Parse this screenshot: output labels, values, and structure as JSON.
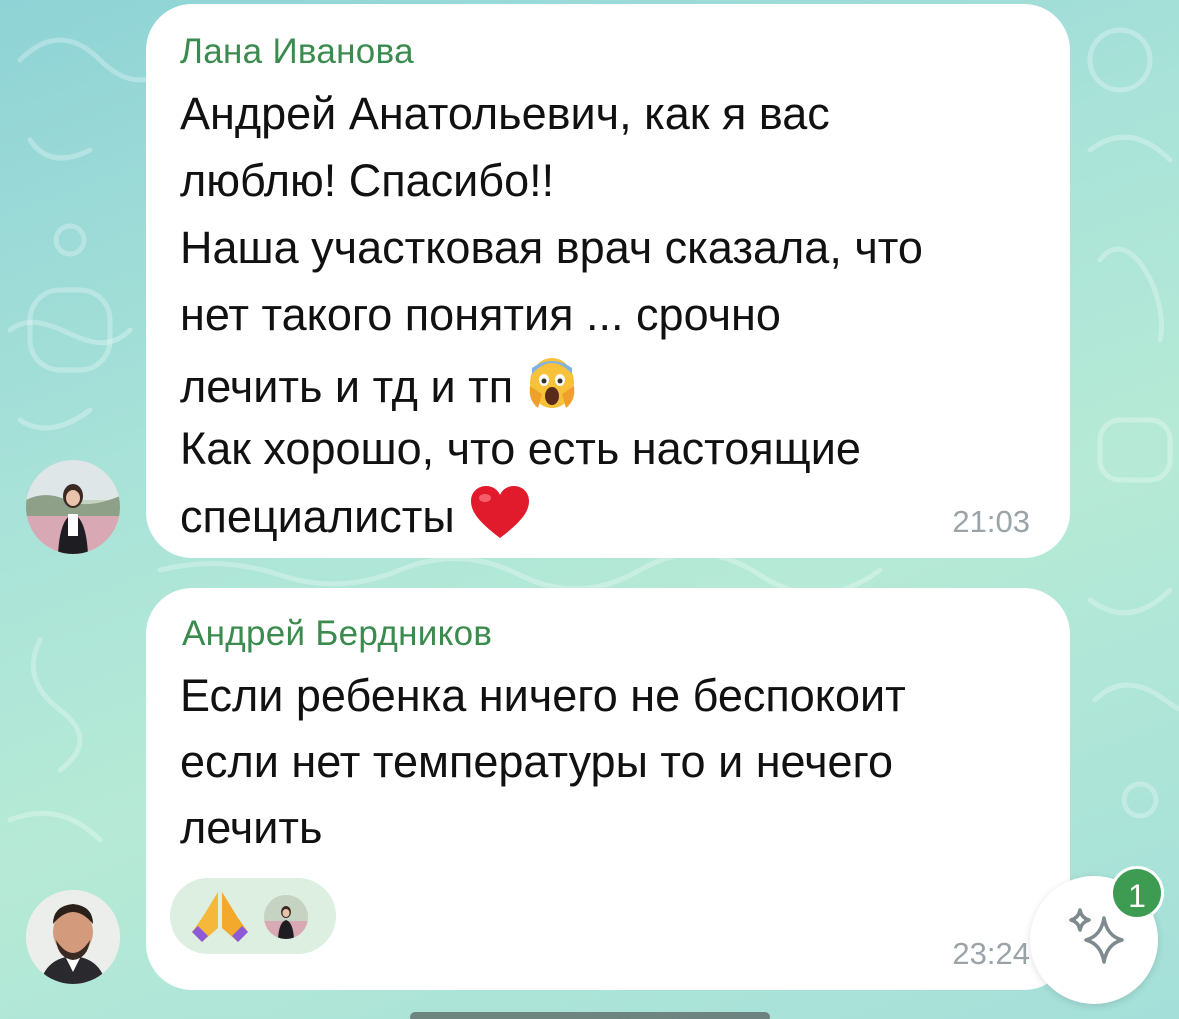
{
  "messages": [
    {
      "sender": "Лана Иванова",
      "lines": [
        "Андрей Анатольевич, как я вас",
        "люблю! Спасибо!!",
        "Наша участковая врач сказала, что",
        "нет такого понятия  ... срочно",
        "лечить и тд и тп",
        "Как хорошо, что есть настоящие",
        "специалисты"
      ],
      "time": "21:03",
      "inline_emojis": [
        "screaming-face-icon",
        "red-heart-icon"
      ]
    },
    {
      "sender": "Андрей Бердников",
      "lines": [
        "Если ребенка ничего не беспокоит",
        "если нет температуры то и нечего",
        "лечить"
      ],
      "time": "23:24",
      "reaction": {
        "emoji": "folded-hands-icon"
      }
    }
  ],
  "fab": {
    "icon": "sparkles-icon",
    "badge": "1"
  },
  "colors": {
    "sender_name": "#3b8b4f",
    "bubble": "#ffffff",
    "badge": "#3e9b52",
    "time": "#9aa3a8"
  }
}
